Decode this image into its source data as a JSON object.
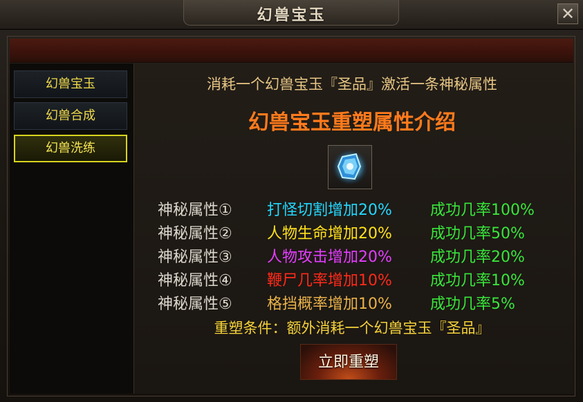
{
  "window": {
    "title": "幻兽宝玉",
    "close_label": "✕"
  },
  "sidebar": {
    "items": [
      {
        "label": "幻兽宝玉",
        "active": false
      },
      {
        "label": "幻兽合成",
        "active": false
      },
      {
        "label": "幻兽洗练",
        "active": true
      }
    ]
  },
  "main": {
    "subtitle": "消耗一个幻兽宝玉『圣品』激活一条神秘属性",
    "heading": "幻兽宝玉重塑属性介绍",
    "item_icon": "blue-gem-icon",
    "attributes": [
      {
        "label": "神秘属性①",
        "effect": "打怪切割增加20%",
        "rate": "成功几率100%",
        "color": "#23d8ff"
      },
      {
        "label": "神秘属性②",
        "effect": "人物生命增加20%",
        "rate": "成功几率50%",
        "color": "#ffe11a"
      },
      {
        "label": "神秘属性③",
        "effect": "人物攻击增加20%",
        "rate": "成功几率20%",
        "color": "#e43dff"
      },
      {
        "label": "神秘属性④",
        "effect": "鞭尸几率增加10%",
        "rate": "成功几率10%",
        "color": "#ff2a1a"
      },
      {
        "label": "神秘属性⑤",
        "effect": "格挡概率增加10%",
        "rate": "成功几率5%",
        "color": "#e9b24a"
      }
    ],
    "condition": "重塑条件：额外消耗一个幻兽宝玉『圣品』",
    "action_label": "立即重塑"
  },
  "colors": {
    "rate": "#38e53b",
    "heading": "#ff7a1c",
    "active_border": "#d7d41e"
  }
}
